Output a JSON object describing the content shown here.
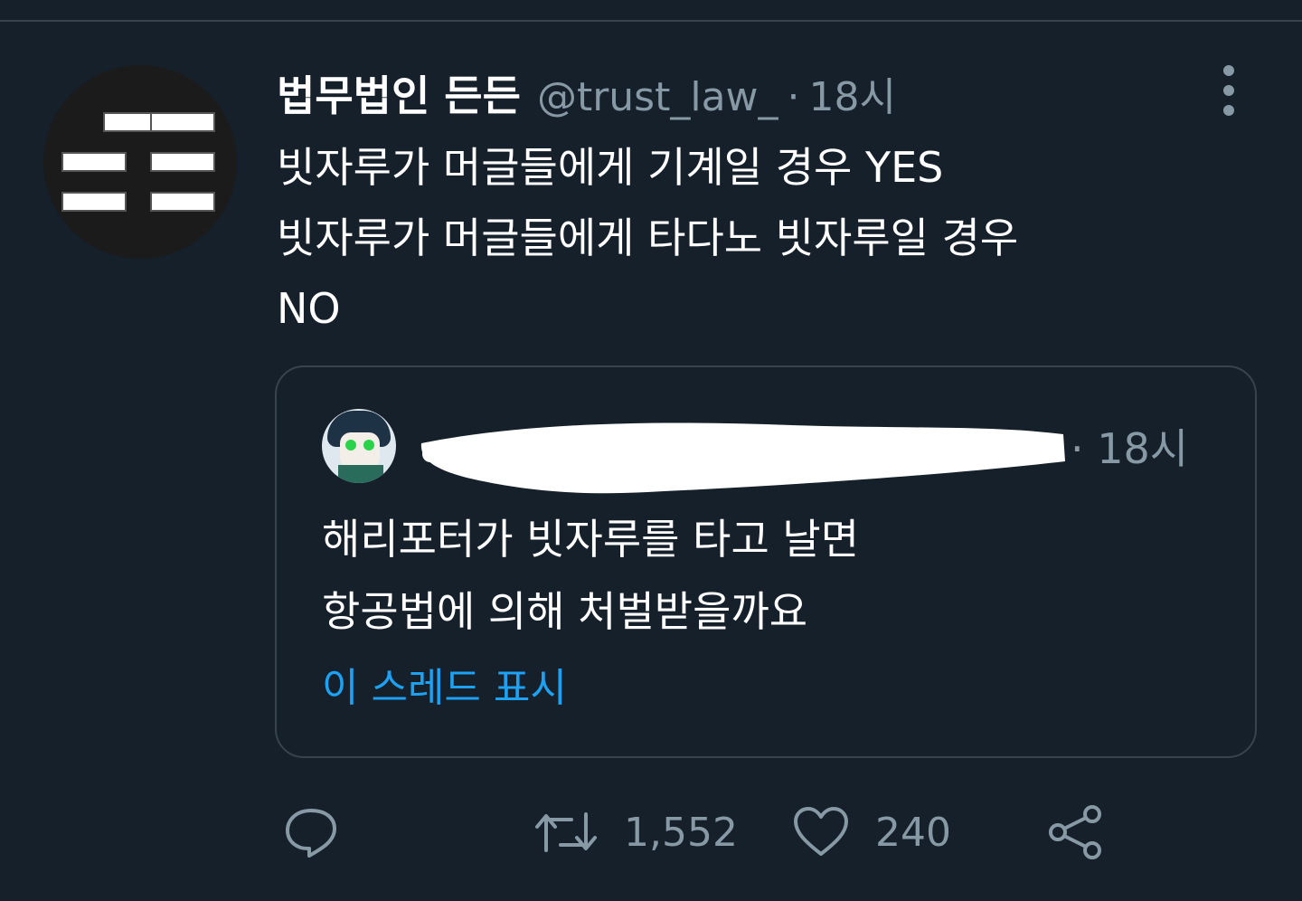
{
  "tweet": {
    "author_name": "법무법인 든든",
    "author_handle": "@trust_law_",
    "separator": "·",
    "time": "18시",
    "lines": [
      "빗자루가 머글들에게 기계일 경우 YES",
      "빗자루가 머글들에게 타다노 빗자루일 경우",
      "NO"
    ]
  },
  "quoted_tweet": {
    "separator": "·",
    "time": "18시",
    "lines": [
      "해리포터가 빗자루를 타고 날면",
      "항공법에 의해 처벌받을까요"
    ],
    "show_thread_label": "이 스레드 표시"
  },
  "actions": {
    "retweet_count": "1,552",
    "like_count": "240"
  },
  "icons": {
    "more": "more-vertical-icon",
    "reply": "reply-icon",
    "retweet": "retweet-icon",
    "like": "heart-icon",
    "share": "share-icon"
  },
  "colors": {
    "background": "#15202b",
    "text_primary": "#ffffff",
    "text_secondary": "#8899a6",
    "link": "#1da1f2",
    "border": "#38444d"
  }
}
